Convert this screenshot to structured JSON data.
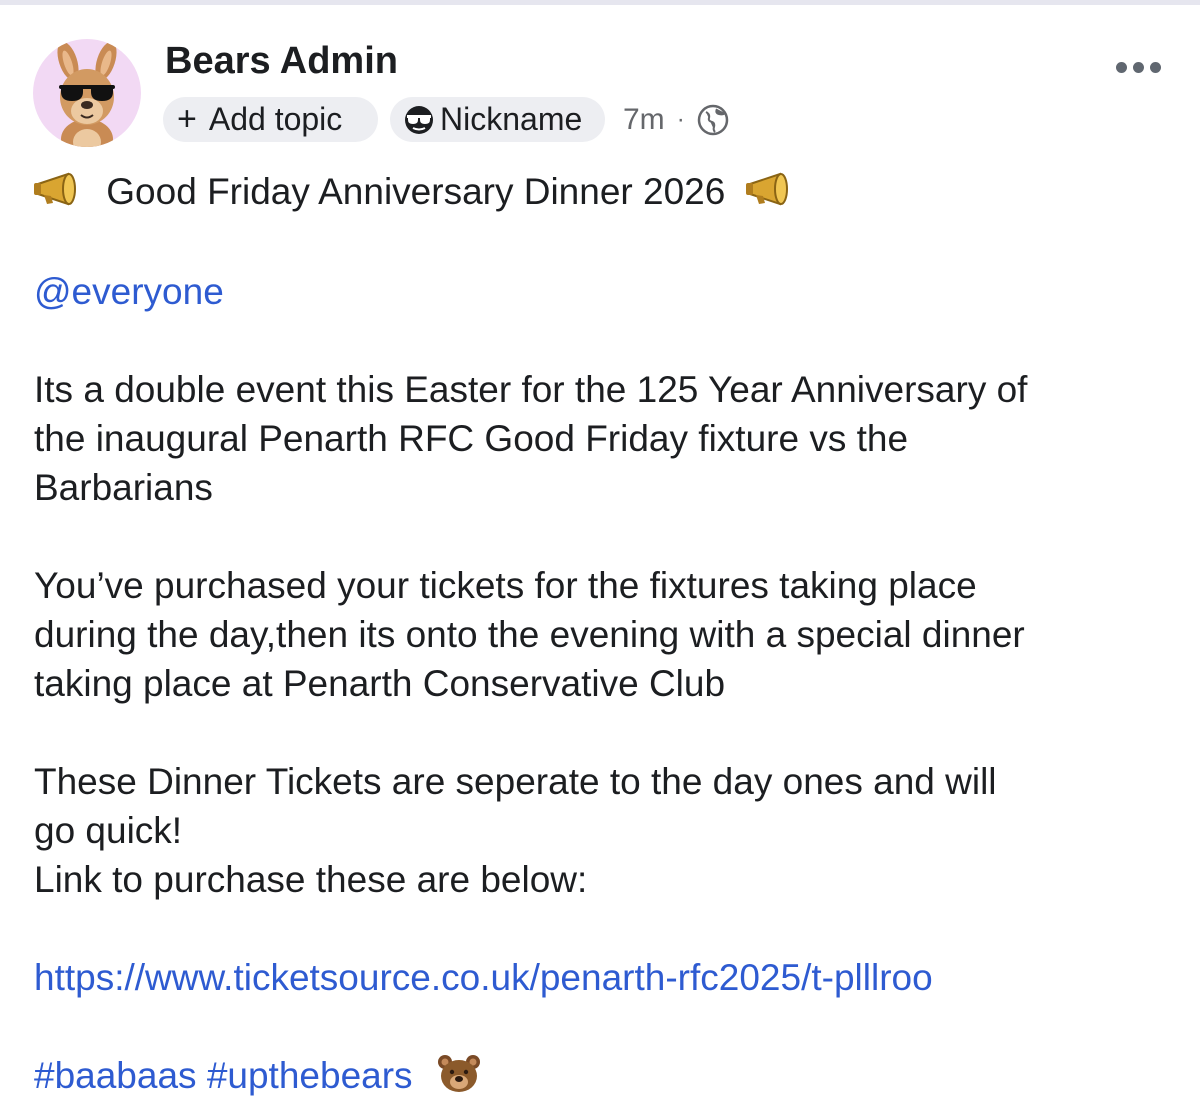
{
  "post": {
    "author": "Bears Admin",
    "add_topic_label": "Add topic",
    "nickname_label": "Nickname",
    "time": "7m",
    "separator": "·",
    "title": "Good Friday Anniversary Dinner 2026",
    "mention": "@everyone",
    "paragraph1": [
      "Its a double event this Easter for the 125 Year Anniversary of",
      "the inaugural Penarth RFC Good Friday fixture vs the",
      "Barbarians"
    ],
    "paragraph2": [
      "You’ve purchased your tickets for the fixtures taking place",
      "during the day,then its onto the evening with a special dinner",
      "taking place at Penarth Conservative Club"
    ],
    "paragraph3": [
      "These Dinner Tickets are seperate to the day ones and will",
      "go quick!",
      "Link to purchase these are below:"
    ],
    "url": "https://www.ticketsource.co.uk/penarth-rfc2025/t-plllroo",
    "hashtags": "#baabaas #upthebears"
  },
  "icons": {
    "avatar": "kangaroo-with-sunglasses-avatar",
    "more": "more-options-icon",
    "globe": "globe-icon",
    "megaphone": "megaphone-emoji",
    "bear": "bear-face-emoji",
    "sunglasses": "sunglasses-emoji"
  },
  "colors": {
    "link": "#2e5bd1",
    "pill_bg": "#edeef2",
    "avatar_bg": "#f2d9f4",
    "muted": "#65676b"
  }
}
